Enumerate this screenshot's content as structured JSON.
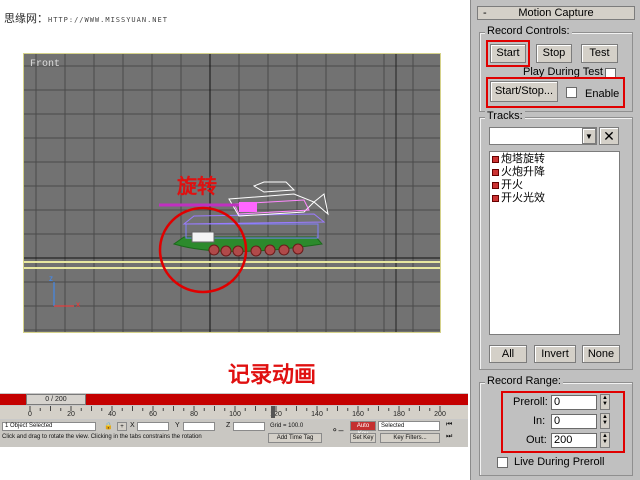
{
  "watermark": {
    "text": "思缘网：",
    "url": "HTTP://WWW.MISSYUAN.NET"
  },
  "viewport": {
    "label": "Front",
    "axis_z": "z",
    "axis_x": "x"
  },
  "annotations": {
    "rotate": "旋转",
    "record": "记录动画"
  },
  "timeline": {
    "slider_label": "0 / 200",
    "ruler_numbers": [
      "0",
      "20",
      "40",
      "60",
      "80",
      "100",
      "120",
      "140",
      "160",
      "180",
      "200"
    ],
    "status_selected": "1 Object Selected",
    "prompt": "Click and drag to rotate the view.  Clicking in the tabs constrains the rotation",
    "x_label": "X",
    "y_label": "Y",
    "z_label": "Z",
    "grid": "Grid = 100.0",
    "add_time_tag": "Add Time Tag",
    "auto_key": "Auto Key",
    "set_key": "Set Key",
    "selected": "Selected",
    "key_filters": "Key Filters..."
  },
  "panel": {
    "rollout_title": "Motion Capture",
    "rollout_minus": "-",
    "record_controls": {
      "title": "Record Controls:",
      "start": "Start",
      "stop": "Stop",
      "test": "Test",
      "play_during_test": "Play During Test",
      "start_stop": "Start/Stop...",
      "enable": "Enable"
    },
    "tracks": {
      "title": "Tracks:",
      "items": [
        "炮塔旋转",
        "火炮升降",
        "开火",
        "开火光效"
      ],
      "all": "All",
      "invert": "Invert",
      "none": "None"
    },
    "record_range": {
      "title": "Record Range:",
      "preroll_label": "Preroll:",
      "preroll_value": "0",
      "in_label": "In:",
      "in_value": "0",
      "out_label": "Out:",
      "out_value": "200",
      "live_during_preroll": "Live During Preroll"
    }
  },
  "colors": {
    "annotation_red": "#e00000",
    "timeline_red": "#c40000",
    "viewport_gray": "#727272"
  }
}
